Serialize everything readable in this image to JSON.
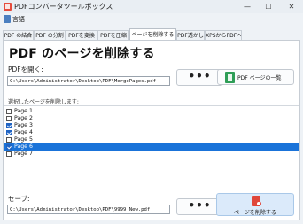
{
  "window": {
    "title": "PDFコンバータツールボックス",
    "minimize": "—",
    "maximize": "☐",
    "close": "✕"
  },
  "menu": {
    "label": "言語"
  },
  "tabs": [
    {
      "label": "PDF の結合"
    },
    {
      "label": "PDF の分割"
    },
    {
      "label": "PDFを変換"
    },
    {
      "label": "PDFを圧縮"
    },
    {
      "label": "ページを削除する"
    },
    {
      "label": "PDF透かし"
    },
    {
      "label": "XPSからPDFへ"
    }
  ],
  "active_tab": "ページを削除する",
  "main": {
    "heading": "PDF のページを削除する",
    "open_label": "PDFを開く:",
    "open_path": "C:\\Users\\Administrator\\Desktop\\PDF\\MergePages.pdf",
    "browse_label": "•••",
    "page_list_button": "PDF ページの一覧",
    "select_label": "選択したページを削除します:",
    "pages": [
      {
        "label": "Page 1",
        "checked": false,
        "selected": false
      },
      {
        "label": "Page 2",
        "checked": false,
        "selected": false
      },
      {
        "label": "Page 3",
        "checked": true,
        "selected": false
      },
      {
        "label": "Page 4",
        "checked": true,
        "selected": false
      },
      {
        "label": "Page 5",
        "checked": false,
        "selected": false
      },
      {
        "label": "Page 6",
        "checked": true,
        "selected": true
      },
      {
        "label": "Page 7",
        "checked": false,
        "selected": false
      }
    ],
    "save_label": "セーブ:",
    "save_path": "C:\\Users\\Administrator\\Desktop\\PDF\\9999_New.pdf",
    "save_browse_label": "•••",
    "delete_button": "ページを削除する"
  }
}
